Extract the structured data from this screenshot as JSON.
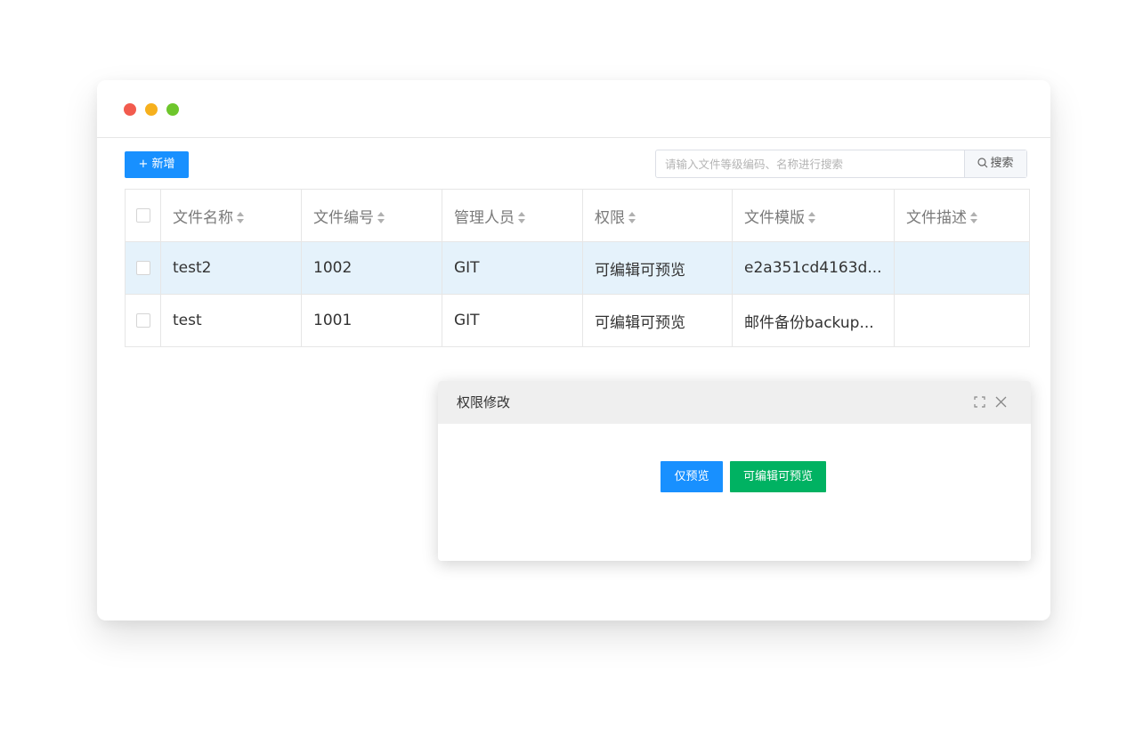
{
  "toolbar": {
    "add_label": "+ 新增",
    "search_placeholder": "请输入文件等级编码、名称进行搜索",
    "search_button": "搜索"
  },
  "table": {
    "headers": [
      "文件名称",
      "文件编号",
      "管理人员",
      "权限",
      "文件模版",
      "文件描述"
    ],
    "rows": [
      {
        "name": "test2",
        "number": "1002",
        "manager": "GIT",
        "permission": "可编辑可预览",
        "template": "e2a351cd4163d...",
        "description": "",
        "selected": true
      },
      {
        "name": "test",
        "number": "1001",
        "manager": "GIT",
        "permission": "可编辑可预览",
        "template": "邮件备份backup...",
        "description": "",
        "selected": false
      }
    ]
  },
  "modal": {
    "title": "权限修改",
    "preview_only_label": "仅预览",
    "edit_preview_label": "可编辑可预览"
  },
  "colors": {
    "primary": "#1890ff",
    "success": "#00b262",
    "selected_row": "#e5f2fb"
  }
}
